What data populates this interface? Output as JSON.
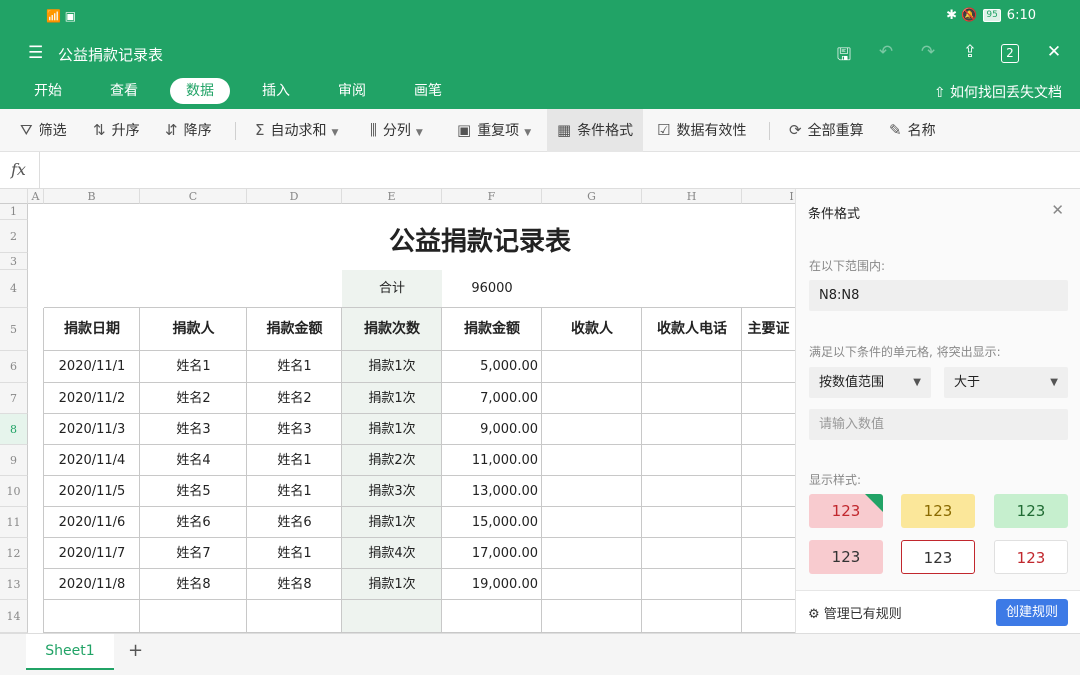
{
  "status": {
    "left": "📶 ▣",
    "right_icons": "✱ 🔕",
    "battery": "95",
    "time": "6:10"
  },
  "titlebar": {
    "menu": "☰",
    "title": "公益捐款记录表",
    "save": "🖫",
    "undo": "↶",
    "redo": "↷",
    "share": "⇪",
    "windows": "2",
    "close": "✕"
  },
  "tabs": [
    "开始",
    "查看",
    "数据",
    "插入",
    "审阅",
    "画笔"
  ],
  "help": "⇧ 如何找回丢失文档",
  "ribbon": [
    {
      "icon": "⛛",
      "label": "筛选"
    },
    {
      "icon": "⇅",
      "label": "升序"
    },
    {
      "icon": "⇵",
      "label": "降序"
    },
    {
      "icon": "Σ",
      "label": "自动求和"
    },
    {
      "icon": "⫼",
      "label": "分列"
    },
    {
      "icon": "▣",
      "label": "重复项"
    },
    {
      "icon": "▦",
      "label": "条件格式"
    },
    {
      "icon": "☑",
      "label": "数据有效性"
    },
    {
      "icon": "⟳",
      "label": "全部重算"
    },
    {
      "icon": "✎",
      "label": "名称"
    }
  ],
  "formula": {
    "fx": "fx"
  },
  "columns": [
    "A",
    "B",
    "C",
    "D",
    "E",
    "F",
    "G",
    "H",
    "I"
  ],
  "rows": [
    "1",
    "2",
    "3",
    "4",
    "5",
    "6",
    "7",
    "8",
    "9",
    "10",
    "11",
    "12",
    "13",
    "14"
  ],
  "sheet": {
    "title": "公益捐款记录表",
    "total_label": "合计",
    "total_value": "96000",
    "headers": [
      "捐款日期",
      "捐款人",
      "捐款金额",
      "捐款次数",
      "捐款金额",
      "收款人",
      "收款人电话",
      "主要证"
    ],
    "data": [
      [
        "2020/11/1",
        "姓名1",
        "姓名1",
        "捐款1次",
        "5,000.00"
      ],
      [
        "2020/11/2",
        "姓名2",
        "姓名2",
        "捐款1次",
        "7,000.00"
      ],
      [
        "2020/11/3",
        "姓名3",
        "姓名3",
        "捐款1次",
        "9,000.00"
      ],
      [
        "2020/11/4",
        "姓名4",
        "姓名1",
        "捐款2次",
        "11,000.00"
      ],
      [
        "2020/11/5",
        "姓名5",
        "姓名1",
        "捐款3次",
        "13,000.00"
      ],
      [
        "2020/11/6",
        "姓名6",
        "姓名6",
        "捐款1次",
        "15,000.00"
      ],
      [
        "2020/11/7",
        "姓名7",
        "姓名1",
        "捐款4次",
        "17,000.00"
      ],
      [
        "2020/11/8",
        "姓名8",
        "姓名8",
        "捐款1次",
        "19,000.00"
      ]
    ]
  },
  "panel": {
    "title": "条件格式",
    "close": "✕",
    "range_label": "在以下范围内:",
    "range_value": "N8:N8",
    "cond_label": "满足以下条件的单元格, 将突出显示:",
    "cond_type": "按数值范围",
    "cond_op": "大于",
    "value_placeholder": "请输入数值",
    "style_label": "显示样式:",
    "swatches": [
      "123",
      "123",
      "123",
      "123",
      "123",
      "123"
    ],
    "manage": "⚙ 管理已有规则",
    "create": "创建规则"
  },
  "sheettab": {
    "name": "Sheet1",
    "add": "+"
  },
  "colors": {
    "green": "#21a366",
    "selected_row": "#21a366",
    "highlight_col": "#eef3ef",
    "blue_button": "#3d7ae6"
  }
}
